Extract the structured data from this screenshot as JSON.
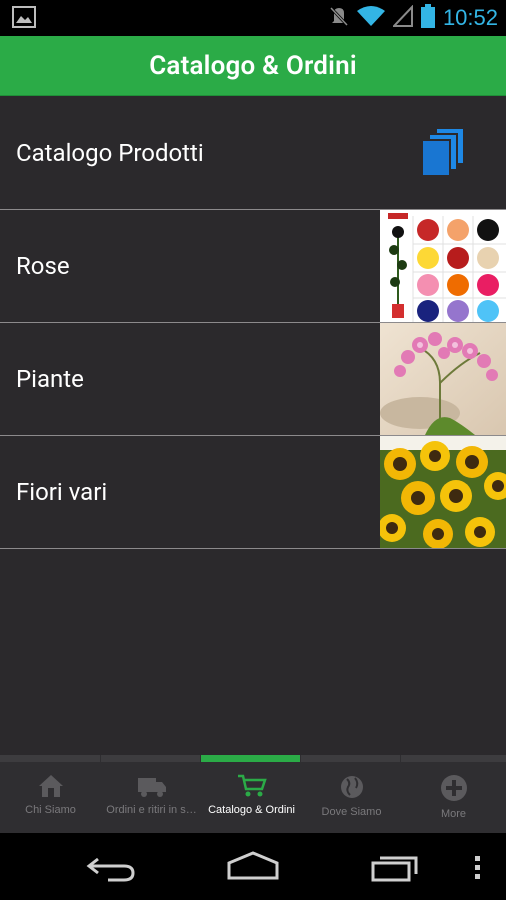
{
  "status_bar": {
    "time": "10:52",
    "icons": [
      "gallery-notification-icon",
      "mute-icon",
      "wifi-icon",
      "signal-icon",
      "battery-icon"
    ],
    "accent_color": "#33b5e5"
  },
  "action_bar": {
    "title": "Catalogo & Ordini",
    "color": "#2bab47"
  },
  "list": {
    "items": [
      {
        "label": "Catalogo Prodotti",
        "thumb": "stack-icon"
      },
      {
        "label": "Rose",
        "thumb": "roses-photo"
      },
      {
        "label": "Piante",
        "thumb": "orchid-photo"
      },
      {
        "label": "Fiori vari",
        "thumb": "sunflowers-photo"
      }
    ]
  },
  "bottom_tabs": {
    "active_index": 2,
    "items": [
      {
        "label": "Chi Siamo",
        "icon": "home-icon"
      },
      {
        "label": "Ordini e ritiri in s…",
        "icon": "truck-icon"
      },
      {
        "label": "Catalogo & Ordini",
        "icon": "cart-icon"
      },
      {
        "label": "Dove Siamo",
        "icon": "globe-icon"
      },
      {
        "label": "More",
        "icon": "plus-circle-icon"
      }
    ]
  },
  "nav_bar": {
    "buttons": [
      "back-icon",
      "home-icon",
      "recents-icon",
      "overflow-menu-icon"
    ]
  }
}
